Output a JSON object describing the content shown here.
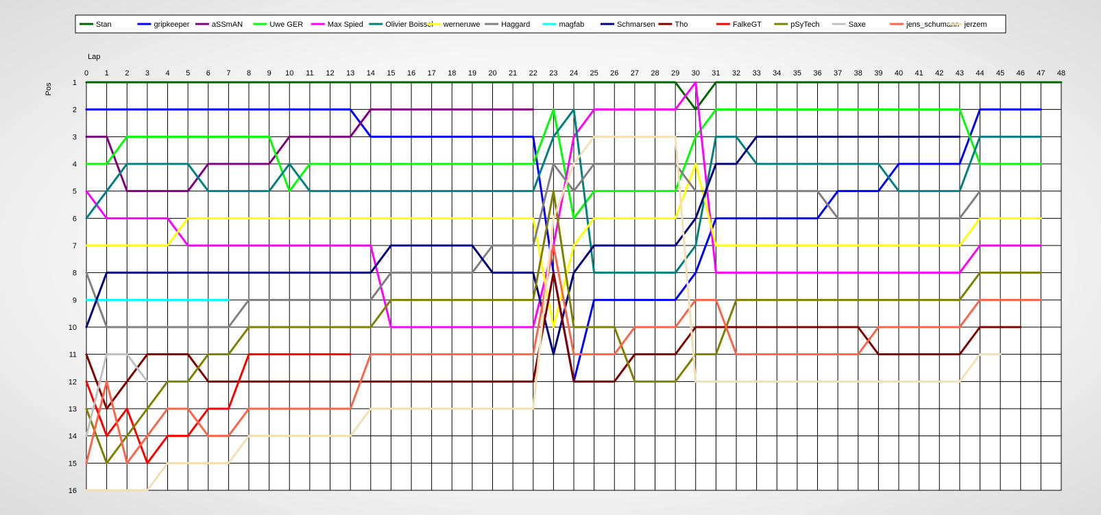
{
  "chart_data": {
    "type": "line",
    "title": "",
    "xlabel": "Lap",
    "ylabel": "Pos",
    "xlim": [
      0,
      48
    ],
    "ylim": [
      1,
      16
    ],
    "y_inverted": true,
    "grid": true,
    "legend_position": "top",
    "x_ticks": [
      0,
      1,
      2,
      3,
      4,
      5,
      6,
      7,
      8,
      9,
      10,
      11,
      12,
      13,
      14,
      15,
      16,
      17,
      18,
      19,
      20,
      21,
      22,
      23,
      24,
      25,
      26,
      27,
      28,
      29,
      30,
      31,
      32,
      33,
      34,
      35,
      36,
      37,
      38,
      39,
      40,
      41,
      42,
      43,
      44,
      45,
      46,
      47,
      48
    ],
    "y_ticks": [
      1,
      2,
      3,
      4,
      5,
      6,
      7,
      8,
      9,
      10,
      11,
      12,
      13,
      14,
      15,
      16
    ],
    "series": [
      {
        "name": "Stan",
        "color": "#006400",
        "x0": 0,
        "values": [
          1,
          1,
          1,
          1,
          1,
          1,
          1,
          1,
          1,
          1,
          1,
          1,
          1,
          1,
          1,
          1,
          1,
          1,
          1,
          1,
          1,
          1,
          1,
          1,
          1,
          1,
          1,
          1,
          1,
          1,
          2,
          1,
          1,
          1,
          1,
          1,
          1,
          1,
          1,
          1,
          1,
          1,
          1,
          1,
          1,
          1,
          1,
          1,
          1
        ]
      },
      {
        "name": "gripkeeper",
        "color": "#0000FF",
        "x0": 0,
        "values": [
          2,
          2,
          2,
          2,
          2,
          2,
          2,
          2,
          2,
          2,
          2,
          2,
          2,
          2,
          3,
          3,
          3,
          3,
          3,
          3,
          3,
          3,
          3,
          8,
          12,
          9,
          9,
          9,
          9,
          9,
          8,
          6,
          6,
          6,
          6,
          6,
          6,
          5,
          5,
          5,
          4,
          4,
          4,
          4,
          2,
          2,
          2,
          2
        ]
      },
      {
        "name": "aSSmAN",
        "color": "#800080",
        "x0": 0,
        "values": [
          3,
          3,
          5,
          5,
          5,
          5,
          4,
          4,
          4,
          4,
          3,
          3,
          3,
          3,
          2,
          2,
          2,
          2,
          2,
          2,
          2,
          2,
          2
        ]
      },
      {
        "name": "Uwe GER",
        "color": "#00FF00",
        "x0": 0,
        "values": [
          4,
          4,
          3,
          3,
          3,
          3,
          3,
          3,
          3,
          3,
          5,
          4,
          4,
          4,
          4,
          4,
          4,
          4,
          4,
          4,
          4,
          4,
          4,
          2,
          6,
          5,
          5,
          5,
          5,
          5,
          3,
          2,
          2,
          2,
          2,
          2,
          2,
          2,
          2,
          2,
          2,
          2,
          2,
          2,
          4,
          4,
          4,
          4
        ]
      },
      {
        "name": "Max Spied",
        "color": "#FF00FF",
        "x0": 0,
        "values": [
          5,
          6,
          6,
          6,
          6,
          7,
          7,
          7,
          7,
          7,
          7,
          7,
          7,
          7,
          7,
          10,
          10,
          10,
          10,
          10,
          10,
          10,
          10,
          7,
          3,
          2,
          2,
          2,
          2,
          2,
          1,
          8,
          8,
          8,
          8,
          8,
          8,
          8,
          8,
          8,
          8,
          8,
          8,
          8,
          7,
          7,
          7,
          7
        ]
      },
      {
        "name": "Olivier Boissel",
        "color": "#008080",
        "x0": 0,
        "values": [
          6,
          5,
          4,
          4,
          4,
          4,
          5,
          5,
          5,
          5,
          4,
          5,
          5,
          5,
          5,
          5,
          5,
          5,
          5,
          5,
          5,
          5,
          5,
          3,
          2,
          8,
          8,
          8,
          8,
          8,
          7,
          3,
          3,
          4,
          4,
          4,
          4,
          4,
          4,
          4,
          5,
          5,
          5,
          5,
          3,
          3,
          3,
          3
        ]
      },
      {
        "name": "werneruwe",
        "color": "#FFFF00",
        "x0": 0,
        "values": [
          7,
          7,
          7,
          7,
          7,
          6,
          6,
          6,
          6,
          6,
          6,
          6,
          6,
          6,
          6,
          6,
          6,
          6,
          6,
          6,
          6,
          6,
          6,
          10,
          7,
          6,
          6,
          6,
          6,
          6,
          4,
          7,
          7,
          7,
          7,
          7,
          7,
          7,
          7,
          7,
          7,
          7,
          7,
          7,
          6,
          6,
          6,
          6
        ]
      },
      {
        "name": "Haggard",
        "color": "#808080",
        "x0": 0,
        "values": [
          8,
          10,
          10,
          10,
          10,
          10,
          10,
          10,
          9,
          9,
          9,
          9,
          9,
          9,
          9,
          8,
          8,
          8,
          8,
          8,
          7,
          7,
          7,
          4,
          5,
          4,
          4,
          4,
          4,
          4,
          5,
          5,
          5,
          5,
          5,
          5,
          5,
          6,
          6,
          6,
          6,
          6,
          6,
          6,
          5,
          5,
          5,
          5
        ]
      },
      {
        "name": "magfab",
        "color": "#00FFFF",
        "x0": 0,
        "values": [
          9,
          9,
          9,
          9,
          9,
          9,
          9,
          9
        ]
      },
      {
        "name": "Schmarsen",
        "color": "#000080",
        "x0": 0,
        "values": [
          10,
          8,
          8,
          8,
          8,
          8,
          8,
          8,
          8,
          8,
          8,
          8,
          8,
          8,
          8,
          7,
          7,
          7,
          7,
          7,
          8,
          8,
          8,
          11,
          8,
          7,
          7,
          7,
          7,
          7,
          6,
          4,
          4,
          3,
          3,
          3,
          3,
          3,
          3,
          3,
          3,
          3,
          3,
          3
        ]
      },
      {
        "name": "Tho",
        "color": "#800000",
        "x0": 0,
        "values": [
          11,
          13,
          12,
          11,
          11,
          11,
          12,
          12,
          12,
          12,
          12,
          12,
          12,
          12,
          12,
          12,
          12,
          12,
          12,
          12,
          12,
          12,
          12,
          8,
          12,
          12,
          12,
          11,
          11,
          11,
          10,
          10,
          10,
          10,
          10,
          10,
          10,
          10,
          10,
          11,
          11,
          11,
          11,
          11,
          10,
          10,
          10
        ]
      },
      {
        "name": "FalkeGT",
        "color": "#FF0000",
        "x0": 0,
        "values": [
          12,
          14,
          13,
          15,
          14,
          14,
          13,
          13,
          11,
          11,
          11,
          11,
          11,
          11
        ]
      },
      {
        "name": "pSyTech",
        "color": "#808000",
        "x0": 0,
        "values": [
          13,
          15,
          14,
          13,
          12,
          12,
          11,
          11,
          10,
          10,
          10,
          10,
          10,
          10,
          10,
          9,
          9,
          9,
          9,
          9,
          9,
          9,
          9,
          5,
          10,
          10,
          10,
          12,
          12,
          12,
          11,
          11,
          9,
          9,
          9,
          9,
          9,
          9,
          9,
          9,
          9,
          9,
          9,
          9,
          8,
          8,
          8,
          8
        ]
      },
      {
        "name": "Saxe",
        "color": "#C0C0C0",
        "x0": 0,
        "values": [
          14,
          11,
          11,
          12
        ]
      },
      {
        "name": "jens_schumann",
        "color": "#FF6347",
        "x0": 0,
        "values": [
          15,
          12,
          15,
          14,
          13,
          13,
          14,
          14,
          13,
          13,
          13,
          13,
          13,
          13,
          11,
          11,
          11,
          11,
          11,
          11,
          11,
          11,
          11,
          7,
          11,
          11,
          11,
          10,
          10,
          10,
          9,
          9,
          11,
          11,
          11,
          11,
          11,
          11,
          11,
          10,
          10,
          10,
          10,
          10,
          9,
          9,
          9,
          9
        ]
      },
      {
        "name": "jerzem",
        "color": "#F5DEB3",
        "x0": 0,
        "values": [
          16,
          16,
          16,
          16,
          15,
          15,
          15,
          15,
          14,
          14,
          14,
          14,
          14,
          14,
          13,
          13,
          13,
          13,
          13,
          13,
          13,
          13,
          13,
          6,
          4,
          3,
          3,
          3,
          3,
          3,
          12,
          12,
          12,
          12,
          12,
          12,
          12,
          12,
          12,
          12,
          12,
          12,
          12,
          12,
          11,
          11
        ]
      }
    ]
  }
}
